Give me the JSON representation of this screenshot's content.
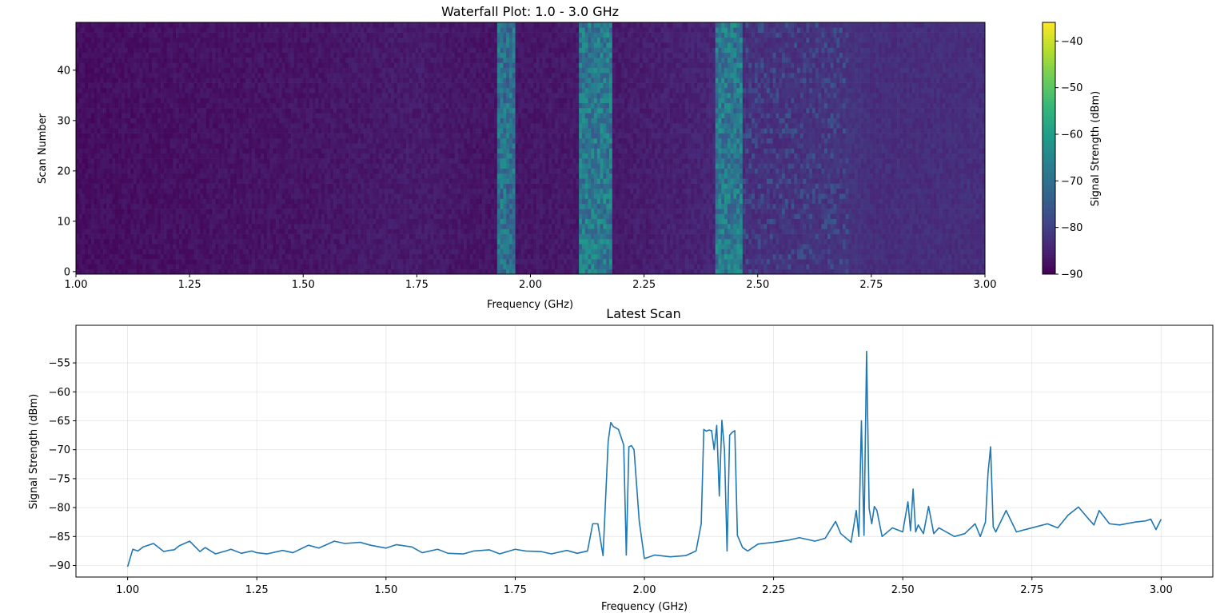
{
  "chart_data": [
    {
      "type": "heatmap",
      "title": "Waterfall Plot: 1.0 - 3.0 GHz",
      "xlabel": "Frequency (GHz)",
      "ylabel": "Scan Number",
      "xlim": [
        1.0,
        3.0
      ],
      "ylim": [
        0,
        49
      ],
      "xticks": [
        "1.00",
        "1.25",
        "1.50",
        "1.75",
        "2.00",
        "2.25",
        "2.50",
        "2.75",
        "3.00"
      ],
      "yticks": [
        "0",
        "10",
        "20",
        "30",
        "40"
      ],
      "colormap": "viridis",
      "n_scans": 50,
      "n_bins": 300,
      "noise_floor_dbm": -87,
      "baseline_profile": [
        {
          "freq": 1.0,
          "dbm": -88
        },
        {
          "freq": 1.5,
          "dbm": -87
        },
        {
          "freq": 1.75,
          "dbm": -86
        },
        {
          "freq": 1.9,
          "dbm": -87
        },
        {
          "freq": 2.2,
          "dbm": -86
        },
        {
          "freq": 2.35,
          "dbm": -85
        },
        {
          "freq": 2.5,
          "dbm": -83
        },
        {
          "freq": 2.72,
          "dbm": -82
        },
        {
          "freq": 2.75,
          "dbm": -83
        },
        {
          "freq": 3.0,
          "dbm": -83
        }
      ],
      "signal_bands": [
        {
          "start_ghz": 1.93,
          "end_ghz": 1.97,
          "mean_dbm": -70
        },
        {
          "start_ghz": 2.11,
          "end_ghz": 2.18,
          "mean_dbm": -68
        },
        {
          "start_ghz": 2.41,
          "end_ghz": 2.465,
          "mean_dbm": -68
        },
        {
          "start_ghz": 2.47,
          "end_ghz": 2.7,
          "mean_dbm": -80
        }
      ],
      "colorbar": {
        "label": "Signal Strength (dBm)",
        "range": [
          -90,
          -36
        ],
        "ticks": [
          "-40",
          "-50",
          "-60",
          "-70",
          "-80",
          "-90"
        ]
      }
    },
    {
      "type": "line",
      "title": "Latest Scan",
      "xlabel": "Frequency (GHz)",
      "ylabel": "Signal Strength (dBm)",
      "xlim": [
        0.9,
        3.1
      ],
      "ylim": [
        -92,
        -48.5
      ],
      "xticks": [
        "1.00",
        "1.25",
        "1.50",
        "1.75",
        "2.00",
        "2.25",
        "2.50",
        "2.75",
        "3.00"
      ],
      "yticks": [
        "-55",
        "-60",
        "-65",
        "-70",
        "-75",
        "-80",
        "-85",
        "-90"
      ],
      "grid": true,
      "color": "#1f77b4",
      "x": [
        1.0,
        1.01,
        1.02,
        1.03,
        1.05,
        1.07,
        1.08,
        1.09,
        1.1,
        1.12,
        1.14,
        1.15,
        1.17,
        1.19,
        1.2,
        1.22,
        1.24,
        1.25,
        1.27,
        1.3,
        1.32,
        1.35,
        1.37,
        1.4,
        1.42,
        1.45,
        1.47,
        1.5,
        1.52,
        1.55,
        1.57,
        1.6,
        1.62,
        1.65,
        1.67,
        1.7,
        1.72,
        1.75,
        1.77,
        1.8,
        1.82,
        1.85,
        1.87,
        1.89,
        1.9,
        1.91,
        1.92,
        1.93,
        1.935,
        1.94,
        1.95,
        1.96,
        1.965,
        1.97,
        1.975,
        1.98,
        1.99,
        2.0,
        2.02,
        2.05,
        2.08,
        2.1,
        2.11,
        2.115,
        2.12,
        2.125,
        2.13,
        2.135,
        2.14,
        2.145,
        2.15,
        2.155,
        2.16,
        2.165,
        2.17,
        2.175,
        2.18,
        2.19,
        2.2,
        2.22,
        2.25,
        2.28,
        2.3,
        2.33,
        2.35,
        2.37,
        2.38,
        2.4,
        2.41,
        2.415,
        2.42,
        2.425,
        2.43,
        2.435,
        2.44,
        2.445,
        2.45,
        2.46,
        2.48,
        2.5,
        2.51,
        2.515,
        2.52,
        2.525,
        2.53,
        2.54,
        2.55,
        2.56,
        2.57,
        2.6,
        2.62,
        2.64,
        2.65,
        2.66,
        2.665,
        2.67,
        2.675,
        2.68,
        2.7,
        2.72,
        2.75,
        2.78,
        2.8,
        2.82,
        2.84,
        2.86,
        2.87,
        2.88,
        2.9,
        2.92,
        2.95,
        2.97,
        2.98,
        2.99,
        3.0
      ],
      "y": [
        -90.2,
        -87.2,
        -87.5,
        -86.8,
        -86.2,
        -87.6,
        -87.4,
        -87.3,
        -86.6,
        -85.8,
        -87.6,
        -86.9,
        -88.0,
        -87.5,
        -87.2,
        -87.9,
        -87.5,
        -87.8,
        -88.0,
        -87.4,
        -87.8,
        -86.5,
        -87.0,
        -85.8,
        -86.2,
        -86.0,
        -86.5,
        -87.0,
        -86.4,
        -86.8,
        -87.8,
        -87.2,
        -87.9,
        -88.0,
        -87.5,
        -87.3,
        -88.0,
        -87.2,
        -87.5,
        -87.6,
        -88.0,
        -87.4,
        -87.9,
        -87.5,
        -82.8,
        -82.8,
        -88.3,
        -68.5,
        -65.3,
        -66.0,
        -66.5,
        -69.2,
        -88.2,
        -69.5,
        -69.3,
        -70.0,
        -82.3,
        -88.8,
        -88.2,
        -88.5,
        -88.3,
        -87.5,
        -82.8,
        -66.5,
        -66.8,
        -66.6,
        -66.7,
        -70.0,
        -65.8,
        -78.0,
        -64.9,
        -70.0,
        -87.5,
        -67.5,
        -67.0,
        -66.7,
        -84.8,
        -86.9,
        -87.5,
        -86.3,
        -86.0,
        -85.6,
        -85.2,
        -85.8,
        -85.3,
        -82.4,
        -84.5,
        -86.0,
        -80.5,
        -85.0,
        -65.0,
        -84.8,
        -53.0,
        -80.2,
        -82.8,
        -79.8,
        -80.5,
        -85.0,
        -83.5,
        -84.2,
        -79.0,
        -84.0,
        -76.8,
        -84.2,
        -83.0,
        -84.5,
        -79.8,
        -84.5,
        -83.5,
        -85.0,
        -84.5,
        -82.8,
        -85.0,
        -82.5,
        -74.0,
        -69.5,
        -83.3,
        -84.2,
        -80.5,
        -84.2,
        -83.5,
        -82.8,
        -83.5,
        -81.3,
        -79.9,
        -82.0,
        -83.0,
        -80.5,
        -82.8,
        -83.0,
        -82.5,
        -82.3,
        -82.0,
        -83.8,
        -82.0,
        -82.8,
        -83.0
      ]
    }
  ]
}
